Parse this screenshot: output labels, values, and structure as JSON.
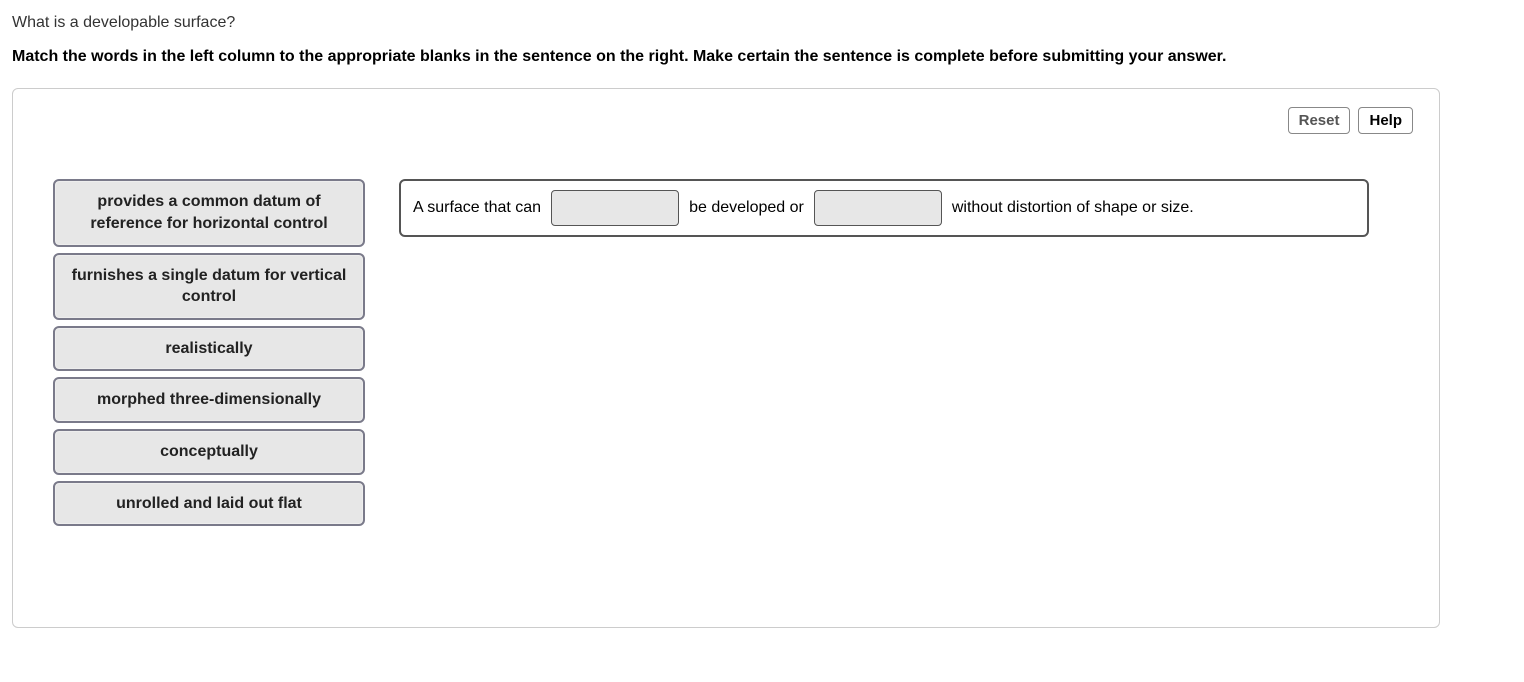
{
  "question": "What is a developable surface?",
  "instructions": "Match the words in the left column to the appropriate blanks in the sentence on the right. Make certain the sentence is complete before submitting your answer.",
  "controls": {
    "reset": "Reset",
    "help": "Help"
  },
  "choices": [
    "provides a common datum of reference for horizontal control",
    "furnishes a single datum for vertical control",
    "realistically",
    "morphed three-dimensionally",
    "conceptually",
    "unrolled and laid out flat"
  ],
  "sentence": {
    "part1": "A surface that can",
    "part2": "be developed or",
    "part3": "without distortion of shape or size."
  }
}
